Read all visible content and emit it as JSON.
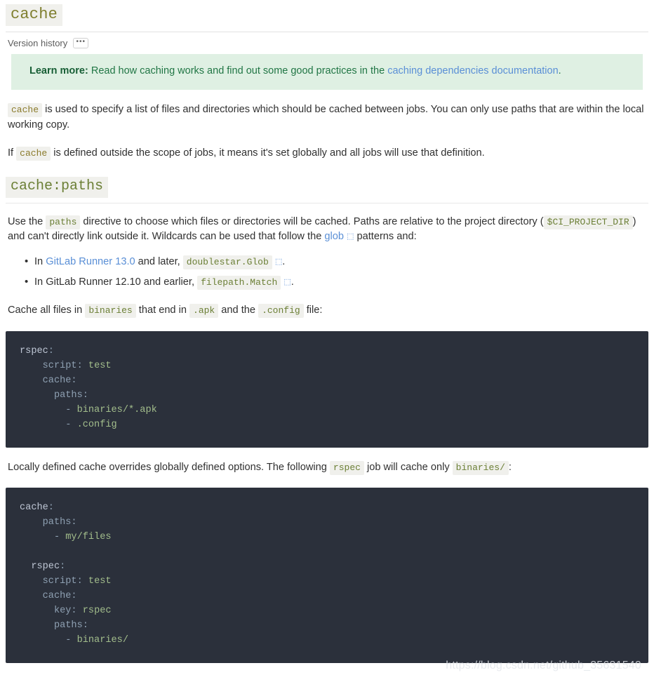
{
  "doc": {
    "title": "cache",
    "version_history_label": "Version history",
    "dots_label": "•••"
  },
  "alert": {
    "strong": "Learn more:",
    "text_before": " Read how caching works and find out some good practices in the ",
    "link": "caching dependencies documentation",
    "text_after": "."
  },
  "paragraphs": {
    "p1_code": "cache",
    "p1_text": " is used to specify a list of files and directories which should be cached between jobs. You can only use paths that are within the local working copy.",
    "p2_lead": "If ",
    "p2_code": "cache",
    "p2_text": " is defined outside the scope of jobs, it means it's set globally and all jobs will use that definition."
  },
  "section": {
    "title": "cache:paths",
    "p3_lead": "Use the ",
    "p3_code": "paths",
    "p3_mid": " directive to choose which files or directories will be cached. Paths are relative to the project directory (",
    "p3_code2": "$CI_PROJECT_DIR",
    "p3_mid2": ") and can't directly link outside it. Wildcards can be used that follow the ",
    "p3_link": "glob",
    "p3_end": " patterns and:",
    "ext_glyph": "⬚"
  },
  "bullets": [
    {
      "lead": "In ",
      "link": "GitLab Runner 13.0",
      "mid": " and later, ",
      "code": "doublestar.Glob",
      "end": "."
    },
    {
      "lead": "In ",
      "plain": "GitLab Runner 12.10",
      "mid": " and earlier, ",
      "code": "filepath.Match",
      "end": "."
    }
  ],
  "cache_intro": {
    "lead": "Cache all files in ",
    "code1": "binaries",
    "mid1": " that end in ",
    "code2": ".apk",
    "mid2": " and the ",
    "code3": ".config",
    "end": " file:"
  },
  "code_block_1": {
    "lines": [
      [
        {
          "t": "rspec",
          "c": "k"
        },
        {
          "t": ":",
          "c": "c"
        }
      ],
      [
        {
          "t": "    script",
          "c": "c"
        },
        {
          "t": ": ",
          "c": "c"
        },
        {
          "t": "test",
          "c": "v"
        }
      ],
      [
        {
          "t": "    cache",
          "c": "c"
        },
        {
          "t": ":",
          "c": "c"
        }
      ],
      [
        {
          "t": "      paths",
          "c": "c"
        },
        {
          "t": ":",
          "c": "c"
        }
      ],
      [
        {
          "t": "        - ",
          "c": "c"
        },
        {
          "t": "binaries/*.apk",
          "c": "d"
        }
      ],
      [
        {
          "t": "        - ",
          "c": "c"
        },
        {
          "t": ".config",
          "c": "d"
        }
      ]
    ]
  },
  "override_text": {
    "lead": "Locally defined cache overrides globally defined options. The following ",
    "code1": "rspec",
    "mid": " job will cache only ",
    "code2": "binaries/",
    "end": ":"
  },
  "code_block_2": {
    "lines": [
      [
        {
          "t": "cache",
          "c": "k"
        },
        {
          "t": ":",
          "c": "c"
        }
      ],
      [
        {
          "t": "    paths",
          "c": "c"
        },
        {
          "t": ":",
          "c": "c"
        }
      ],
      [
        {
          "t": "      - ",
          "c": "c"
        },
        {
          "t": "my/files",
          "c": "d"
        }
      ],
      [
        {
          "t": "",
          "c": "c"
        }
      ],
      [
        {
          "t": "  rspec",
          "c": "k"
        },
        {
          "t": ":",
          "c": "c"
        }
      ],
      [
        {
          "t": "    script",
          "c": "c"
        },
        {
          "t": ": ",
          "c": "c"
        },
        {
          "t": "test",
          "c": "v"
        }
      ],
      [
        {
          "t": "    cache",
          "c": "c"
        },
        {
          "t": ":",
          "c": "c"
        }
      ],
      [
        {
          "t": "      key",
          "c": "c"
        },
        {
          "t": ": ",
          "c": "c"
        },
        {
          "t": "rspec",
          "c": "v"
        }
      ],
      [
        {
          "t": "      paths",
          "c": "c"
        },
        {
          "t": ":",
          "c": "c"
        }
      ],
      [
        {
          "t": "        - ",
          "c": "c"
        },
        {
          "t": "binaries/",
          "c": "d"
        }
      ]
    ]
  },
  "watermark": "https://blog.csdn.net/github_35631540",
  "colors": {
    "code_bg": "#2b303b",
    "inline_code_bg": "#f0f0ec",
    "link": "#5a8fd6",
    "alert_bg": "#dff0e3",
    "alert_text": "#217645",
    "heading": "#6b7f35"
  }
}
